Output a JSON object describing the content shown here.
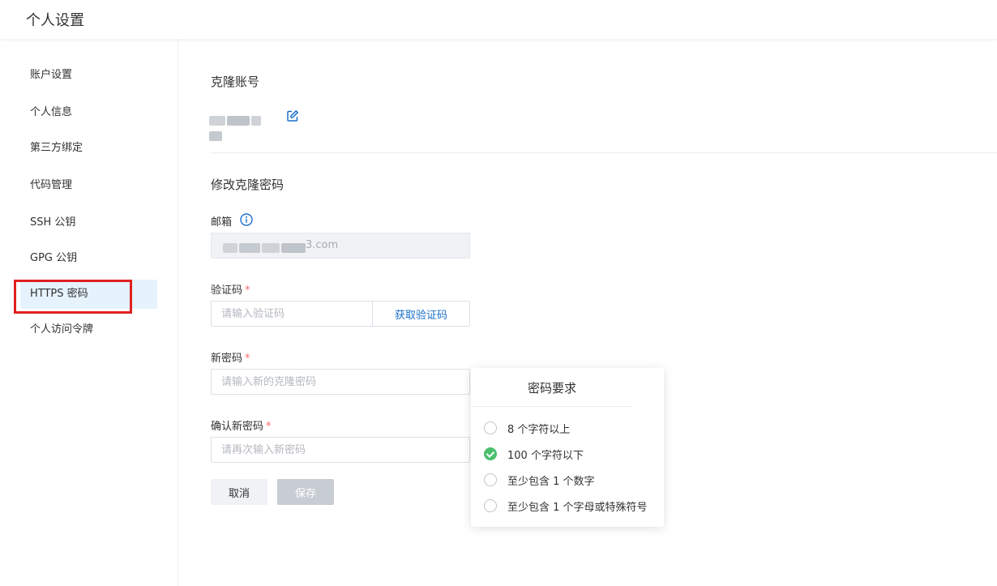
{
  "header": {
    "title": "个人设置"
  },
  "sidebar": {
    "items": [
      {
        "label": "账户设置"
      },
      {
        "label": "个人信息"
      },
      {
        "label": "第三方绑定"
      },
      {
        "label": "代码管理"
      },
      {
        "label": "SSH 公钥"
      },
      {
        "label": "GPG 公钥"
      },
      {
        "label": "HTTPS 密码"
      },
      {
        "label": "个人访问令牌"
      }
    ],
    "active_item": "HTTPS 密码"
  },
  "main": {
    "clone_account": {
      "title": "克隆账号"
    },
    "change_password": {
      "title": "修改克隆密码"
    },
    "email": {
      "label": "邮箱",
      "value_visible_suffix": "3.com"
    },
    "verify_code": {
      "label": "验证码",
      "required_mark": "*",
      "placeholder": "请输入验证码",
      "button": "获取验证码"
    },
    "new_password": {
      "label": "新密码",
      "required_mark": "*",
      "placeholder": "请输入新的克隆密码"
    },
    "confirm_password": {
      "label": "确认新密码",
      "required_mark": "*",
      "placeholder": "请再次输入新密码"
    },
    "buttons": {
      "cancel": "取消",
      "save": "保存"
    }
  },
  "password_popover": {
    "title": "密码要求",
    "rules": [
      {
        "text": "8 个字符以上",
        "met": false
      },
      {
        "text": "100 个字符以下",
        "met": true
      },
      {
        "text": "至少包含 1 个数字",
        "met": false
      },
      {
        "text": "至少包含 1 个字母或特殊符号",
        "met": false
      }
    ]
  },
  "colors": {
    "accent": "#1a6fc9",
    "active_bg": "#e6f3fd",
    "highlight": "#e02020",
    "success": "#4cbf6d",
    "required": "#f56c6c"
  }
}
